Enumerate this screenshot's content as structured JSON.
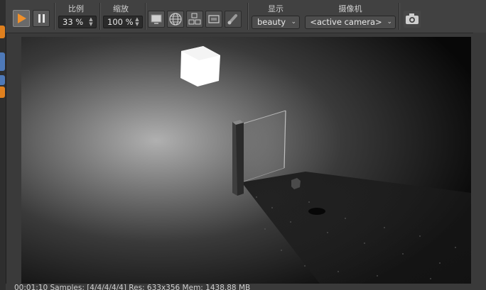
{
  "toolbar": {
    "scale_label": "比例",
    "scale_value": "33 %",
    "zoom_label": "缩放",
    "zoom_value": "100 %",
    "display_label": "显示",
    "display_value": "beauty",
    "camera_label": "摄像机",
    "camera_value": "<active camera>",
    "buttons": {
      "play": "play-icon",
      "pause": "pause-icon",
      "monitor": "monitor-icon",
      "globe": "globe-icon",
      "layout": "layout-icon",
      "frame": "frame-icon",
      "brush": "brush-icon",
      "snapshot": "camera-icon"
    }
  },
  "status": {
    "text": "00:01:10  Samples: [4/4/4/4/4]  Res: 633x356  Mem: 1438.88 MB"
  },
  "colors": {
    "accent_orange": "#f0902a",
    "side_blue": "#4e79b8",
    "toolbar_bg": "#414141"
  }
}
